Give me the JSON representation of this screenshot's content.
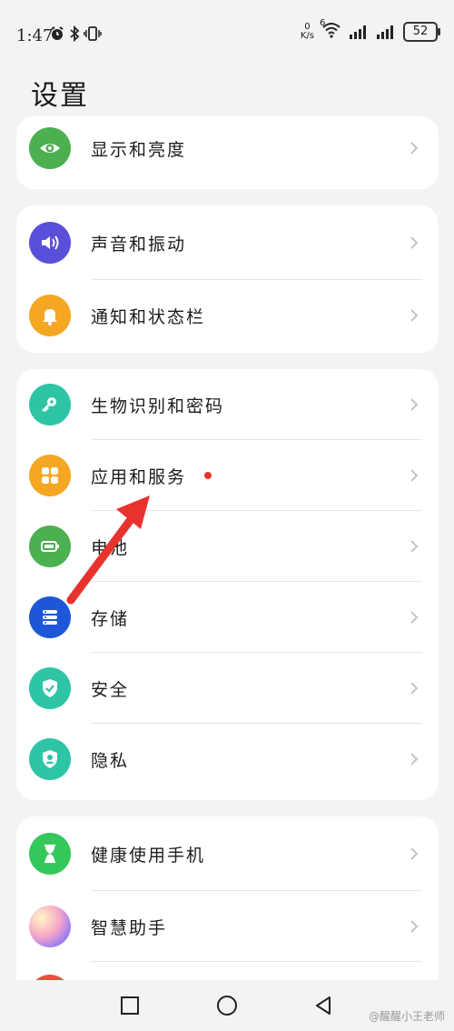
{
  "status": {
    "time": "1:47",
    "net_speed_value": "0",
    "net_speed_unit": "K/s",
    "signal_tag": "6",
    "battery": "52"
  },
  "page": {
    "title": "设置"
  },
  "cards": [
    {
      "items": [
        {
          "label": "显示和亮度",
          "icon": "eye-icon",
          "color": "#4caf50"
        }
      ]
    },
    {
      "items": [
        {
          "label": "声音和振动",
          "icon": "speaker-icon",
          "color": "#5a4fd9"
        },
        {
          "label": "通知和状态栏",
          "icon": "bell-icon",
          "color": "#f5a623"
        }
      ]
    },
    {
      "items": [
        {
          "label": "生物识别和密码",
          "icon": "key-icon",
          "color": "#2ec4a6"
        },
        {
          "label": "应用和服务",
          "icon": "apps-grid-icon",
          "color": "#f5a623",
          "badge": true
        },
        {
          "label": "电池",
          "icon": "battery-icon",
          "color": "#4caf50"
        },
        {
          "label": "存储",
          "icon": "storage-icon",
          "color": "#1e56d8"
        },
        {
          "label": "安全",
          "icon": "shield-check-icon",
          "color": "#2ec4a6"
        },
        {
          "label": "隐私",
          "icon": "privacy-shield-icon",
          "color": "#2ec4a6"
        }
      ]
    },
    {
      "items": [
        {
          "label": "健康使用手机",
          "icon": "hourglass-icon",
          "color": "#34c759"
        },
        {
          "label": "智慧助手",
          "icon": "assistant-orb-icon",
          "color": "#c78cf2"
        }
      ]
    }
  ],
  "nav": {
    "watermark": "@醒醒小王老师"
  },
  "colors": {
    "background": "#f1f3f5",
    "card": "#ffffff",
    "badge": "#e6362b",
    "annotation_arrow": "#e8322e"
  }
}
